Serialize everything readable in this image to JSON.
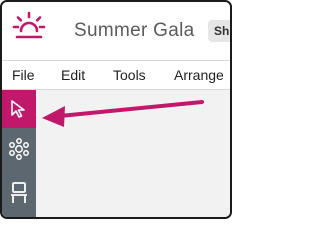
{
  "app": {
    "title": "Summer Gala",
    "header_button": "Sh",
    "logo_icon": "sun-icon",
    "brand_color": "#c2186b"
  },
  "menu": {
    "items": [
      {
        "label": "File"
      },
      {
        "label": "Edit"
      },
      {
        "label": "Tools"
      },
      {
        "label": "Arrange"
      }
    ]
  },
  "toolbar": {
    "tools": [
      {
        "name": "select",
        "icon": "pointer-icon",
        "active": true
      },
      {
        "name": "seating",
        "icon": "table-seats-icon",
        "active": false
      },
      {
        "name": "chair",
        "icon": "chair-icon",
        "active": false
      }
    ],
    "rail_color": "#5d6770"
  },
  "annotation": {
    "arrow_icon": "arrow-left-icon",
    "arrow_color": "#c2186b"
  }
}
